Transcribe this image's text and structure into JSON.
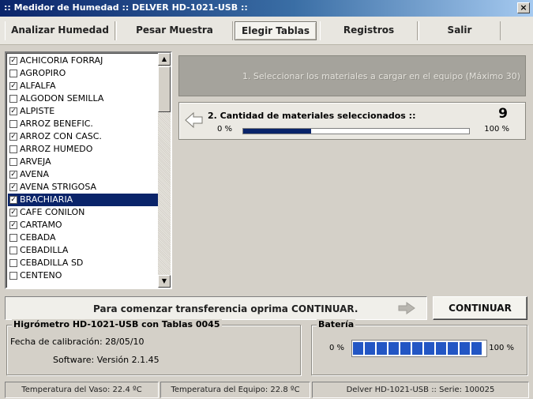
{
  "window": {
    "title": ":: Medidor de Humedad :: DELVER HD-1021-USB ::",
    "close_glyph": "×"
  },
  "menu": [
    {
      "label": "Analizar Humedad",
      "active": false
    },
    {
      "label": "Pesar Muestra",
      "active": false
    },
    {
      "label": "Elegir Tablas",
      "active": true
    },
    {
      "label": "Registros",
      "active": false
    },
    {
      "label": "Salir",
      "active": false
    }
  ],
  "materials": [
    {
      "label": "ACHICORIA FORRAJ",
      "checked": true
    },
    {
      "label": "AGROPIRO",
      "checked": false
    },
    {
      "label": "ALFALFA",
      "checked": true
    },
    {
      "label": "ALGODON SEMILLA",
      "checked": false
    },
    {
      "label": "ALPISTE",
      "checked": true
    },
    {
      "label": "ARROZ BENEFIC.",
      "checked": false
    },
    {
      "label": "ARROZ CON CASC.",
      "checked": true
    },
    {
      "label": "ARROZ HUMEDO",
      "checked": false
    },
    {
      "label": "ARVEJA",
      "checked": false
    },
    {
      "label": "AVENA",
      "checked": true
    },
    {
      "label": "AVENA STRIGOSA",
      "checked": true
    },
    {
      "label": "BRACHIARIA",
      "checked": true,
      "selected": true
    },
    {
      "label": "CAFE CONILON",
      "checked": true
    },
    {
      "label": "CARTAMO",
      "checked": true
    },
    {
      "label": "CEBADA",
      "checked": false
    },
    {
      "label": "CEBADILLA",
      "checked": false
    },
    {
      "label": "CEBADILLA SD",
      "checked": false
    },
    {
      "label": "CENTENO",
      "checked": false
    }
  ],
  "step1": {
    "text": "1. Seleccionar los materiales a cargar en el equipo (Máximo 30)"
  },
  "step2": {
    "label": "2. Cantidad de materiales seleccionados ::",
    "count": "9",
    "min_label": "0 %",
    "max_label": "100 %",
    "progress_fraction": 0.3
  },
  "continue": {
    "message": "Para comenzar transferencia oprima CONTINUAR.",
    "button_label": "CONTINUAR"
  },
  "device": {
    "legend": "Higrómetro HD-1021-USB con Tablas  0045",
    "calibration": "Fecha de calibración: 28/05/10",
    "software": "Software: Versión 2.1.45"
  },
  "battery": {
    "legend": "Batería",
    "min_label": "0 %",
    "max_label": "100 %",
    "level_fraction": 1.0,
    "cells": 11
  },
  "status": {
    "vessel_temp": "Temperatura del Vaso: 22.4 ºC",
    "device_temp": "Temperatura del Equipo: 22.8 ºC",
    "serial": "Delver HD-1021-USB :: Serie: 100025"
  },
  "colors": {
    "selection": "#0a246a",
    "progress": "#0a246a",
    "battery": "#2356c4",
    "face": "#d4d0c8"
  }
}
